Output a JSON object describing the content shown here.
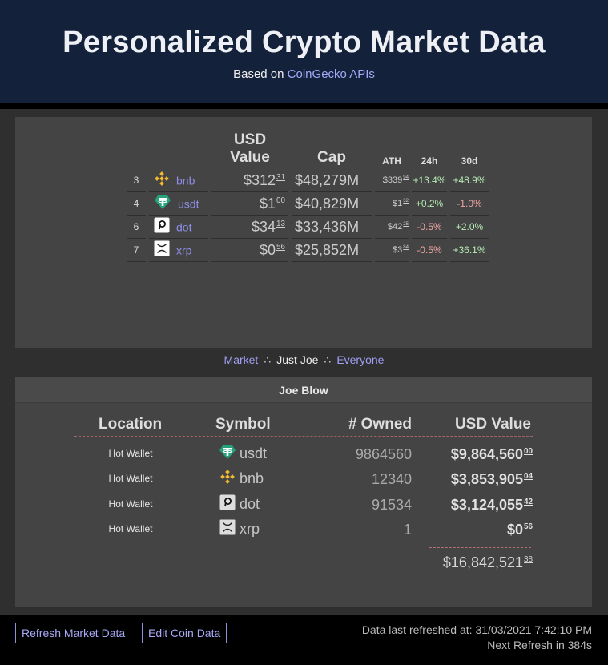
{
  "header": {
    "title": "Personalized Crypto Market Data",
    "subtitle_prefix": "Based on",
    "subtitle_link": "CoinGecko APIs"
  },
  "market": {
    "columns": {
      "usd": "USD Value",
      "cap": "Cap",
      "ath": "ATH",
      "change24": "24h",
      "change30": "30d"
    },
    "rows": [
      {
        "rank": "3",
        "coin": "bnb",
        "icon": "bnb-icon",
        "usd_main": "$312",
        "usd_cents": "31",
        "cap": "$48,279M",
        "ath_main": "$339",
        "ath_cents": "94",
        "change24": "+13.4%",
        "change30": "+48.9%"
      },
      {
        "rank": "4",
        "coin": "usdt",
        "icon": "tether-icon",
        "usd_main": "$1",
        "usd_cents": "00",
        "cap": "$40,829M",
        "ath_main": "$1",
        "ath_cents": "32",
        "change24": "+0.2%",
        "change30": "-1.0%"
      },
      {
        "rank": "6",
        "coin": "dot",
        "icon": "polkadot-icon",
        "usd_main": "$34",
        "usd_cents": "13",
        "cap": "$33,436M",
        "ath_main": "$42",
        "ath_cents": "25",
        "change24": "-0.5%",
        "change30": "+2.0%"
      },
      {
        "rank": "7",
        "coin": "xrp",
        "icon": "xrp-icon",
        "usd_main": "$0",
        "usd_cents": "56",
        "cap": "$25,852M",
        "ath_main": "$3",
        "ath_cents": "84",
        "change24": "-0.5%",
        "change30": "+36.1%"
      }
    ]
  },
  "nav": {
    "market": "Market",
    "sep": "∴",
    "just_joe": "Just Joe",
    "everyone": "Everyone"
  },
  "portfolio": {
    "owner": "Joe Blow",
    "columns": {
      "location": "Location",
      "symbol": "Symbol",
      "owned": "# Owned",
      "usd": "USD Value"
    },
    "rows": [
      {
        "location": "Hot Wallet",
        "symbol": "usdt",
        "owned": "9864560",
        "usd_main": "$9,864,560",
        "usd_cents": "00"
      },
      {
        "location": "Hot Wallet",
        "symbol": "bnb",
        "owned": "12340",
        "usd_main": "$3,853,905",
        "usd_cents": "04"
      },
      {
        "location": "Hot Wallet",
        "symbol": "dot",
        "owned": "91534",
        "usd_main": "$3,124,055",
        "usd_cents": "42"
      },
      {
        "location": "Hot Wallet",
        "symbol": "xrp",
        "owned": "1",
        "usd_main": "$0",
        "usd_cents": "56"
      }
    ],
    "total_main": "$16,842,521",
    "total_cents": "38"
  },
  "footer": {
    "refresh_button": "Refresh Market Data",
    "edit_button": "Edit Coin Data",
    "last_refreshed": "Data last refreshed at: 31/03/2021 7:42:10 PM",
    "next_refresh": "Next Refresh in 384s"
  },
  "colors": {
    "header_bg": "#13223a",
    "link": "#9f9ff5",
    "positive": "#b6ecb6",
    "negative": "#f0a4a4",
    "panel": "#444444"
  }
}
